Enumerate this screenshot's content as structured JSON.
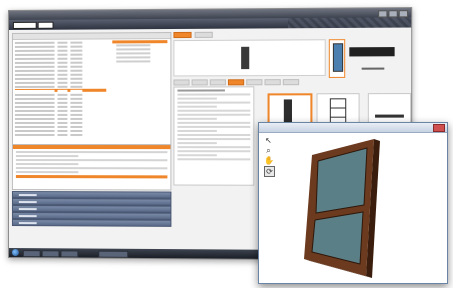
{
  "colors": {
    "accent": "#f0862a",
    "window_frame": "#6a84a6",
    "door_wood": "#6b3a1f",
    "door_glass": "#5a7f86"
  },
  "back_window": {
    "title": "",
    "logo_text": "",
    "icons": [
      "window-minimize-icon",
      "window-maximize-icon",
      "window-close-icon"
    ]
  },
  "front_window": {
    "title": "",
    "tools": [
      {
        "name": "pointer-tool-icon",
        "glyph": "↖"
      },
      {
        "name": "zoom-tool-icon",
        "glyph": "⌕"
      },
      {
        "name": "pan-tool-icon",
        "glyph": "✋"
      },
      {
        "name": "rotate-tool-icon",
        "glyph": "⟳"
      }
    ]
  }
}
